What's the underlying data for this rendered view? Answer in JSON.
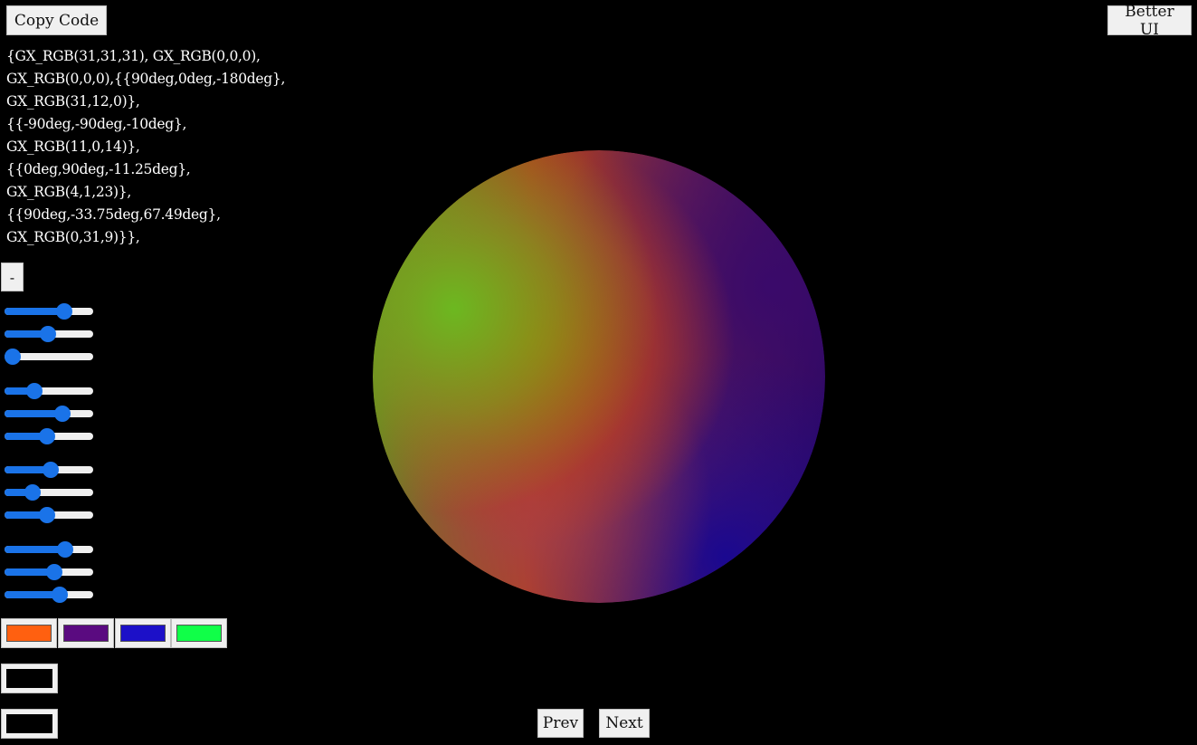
{
  "toolbar": {
    "copy_label": "Copy Code",
    "better_label": "Better UI"
  },
  "code_lines": [
    "{GX_RGB(31,31,31), GX_RGB(0,0,0),",
    "GX_RGB(0,0,0),{{90deg,0deg,-180deg},",
    "GX_RGB(31,12,0)},",
    "{{-90deg,-90deg,-10deg},",
    "GX_RGB(11,0,14)},",
    "{{0deg,90deg,-11.25deg},",
    "GX_RGB(4,1,23)},",
    "{{90deg,-33.75deg,67.49deg},",
    "GX_RGB(0,31,9)}},"
  ],
  "collapse_label": "-",
  "slider_groups": [
    [
      0.71,
      0.49,
      0.0
    ],
    [
      0.3,
      0.69,
      0.48
    ],
    [
      0.52,
      0.28,
      0.48
    ],
    [
      0.72,
      0.58,
      0.65
    ]
  ],
  "swatches": [
    "#ff6010",
    "#5a0a80",
    "#1c10c8",
    "#10ff48"
  ],
  "color_inputs": [
    "#000000",
    "#000000"
  ],
  "nav": {
    "prev_label": "Prev",
    "next_label": "Next"
  },
  "sphere_colors": {
    "top_left": "#6cb820",
    "center": "#b84210",
    "right": "#3a0a6a",
    "bottom_right": "#1a0890",
    "bottom": "#8a3070"
  }
}
